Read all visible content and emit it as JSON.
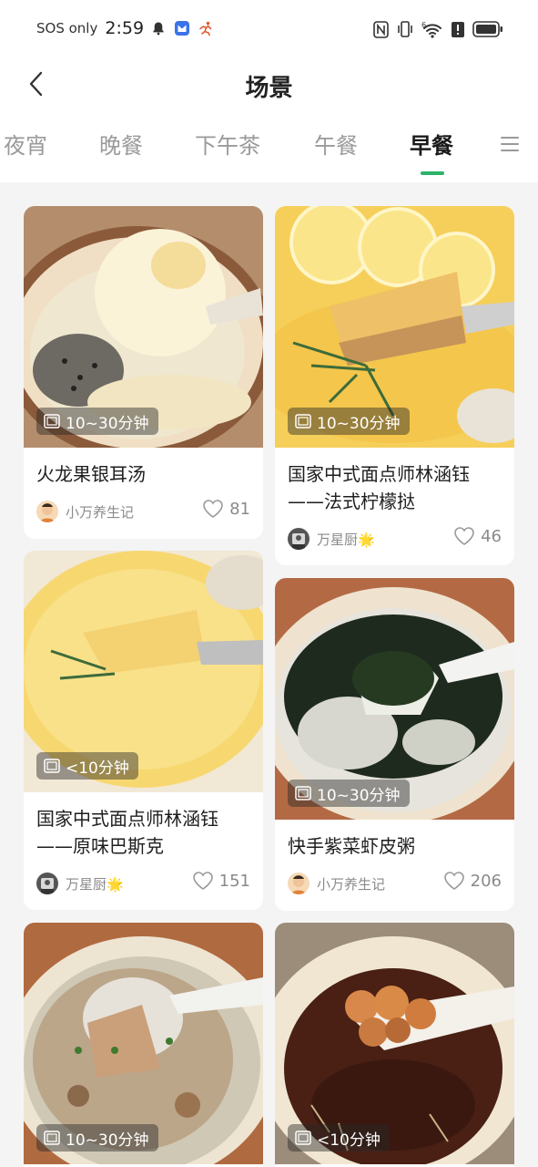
{
  "status_bar": {
    "sos": "SOS only",
    "time": "2:59",
    "left_icons": [
      "bell-icon",
      "app-notification-icon",
      "runner-icon"
    ],
    "right_icons": [
      "nfc-icon",
      "vibrate-icon",
      "wifi-icon",
      "alert-icon",
      "battery-icon"
    ],
    "wifi_label": "6"
  },
  "header": {
    "back_icon": "chevron-left-icon",
    "title": "场景"
  },
  "tabs": {
    "items": [
      {
        "label": "夜宵"
      },
      {
        "label": "晚餐"
      },
      {
        "label": "下午茶"
      },
      {
        "label": "午餐"
      },
      {
        "label": "早餐",
        "active": true
      }
    ],
    "menu_icon": "menu-icon",
    "accent_color": "#2cb36a"
  },
  "recipes": [
    {
      "title_lines": [
        "火龙果银耳汤"
      ],
      "time": "10~30分钟",
      "author": "小万养生记",
      "likes": "81"
    },
    {
      "title_lines": [
        "国家中式面点师林涵钰",
        "——法式柠檬挞"
      ],
      "time": "10~30分钟",
      "author": "万星厨🌟",
      "likes": "46"
    },
    {
      "title_lines": [
        "国家中式面点师林涵钰",
        "——原味巴斯克"
      ],
      "time": "<10分钟",
      "author": "万星厨🌟",
      "likes": "151"
    },
    {
      "title_lines": [
        "快手紫菜虾皮粥"
      ],
      "time": "10~30分钟",
      "author": "小万养生记",
      "likes": "206"
    },
    {
      "title_lines": [],
      "time": "10~30分钟",
      "author": "",
      "likes": ""
    },
    {
      "title_lines": [],
      "time": "<10分钟",
      "author": "",
      "likes": ""
    }
  ]
}
